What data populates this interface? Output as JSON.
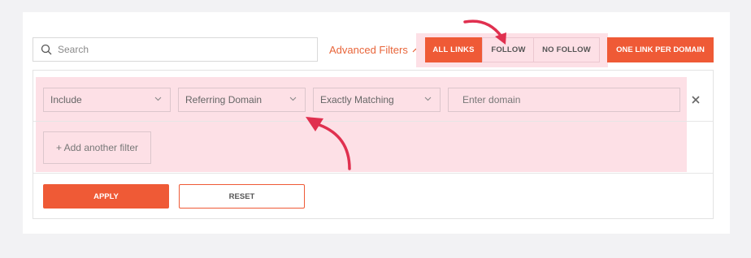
{
  "search": {
    "placeholder": "Search",
    "icon": "search-icon"
  },
  "advanced_filters": {
    "label": "Advanced Filters",
    "icon": "chevron-up-icon"
  },
  "link_type": {
    "options": [
      "ALL LINKS",
      "FOLLOW",
      "NO FOLLOW"
    ],
    "selected": "ALL LINKS"
  },
  "one_link_per_domain": {
    "label": "ONE LINK PER DOMAIN"
  },
  "filter": {
    "mode": "Include",
    "field": "Referring Domain",
    "match": "Exactly Matching",
    "value_placeholder": "Enter domain",
    "remove_icon": "close-icon"
  },
  "add_filter": {
    "label": "+ Add another filter"
  },
  "actions": {
    "apply": "APPLY",
    "reset": "RESET"
  },
  "colors": {
    "accent": "#ef5a36",
    "highlight": "#fde0e6",
    "annotation_arrow": "#e0304f"
  }
}
